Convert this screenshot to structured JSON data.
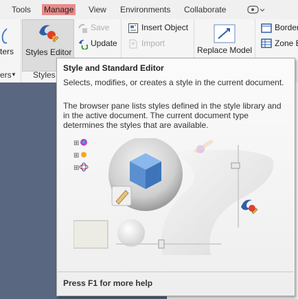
{
  "menubar": {
    "items": [
      {
        "label": "Tools"
      },
      {
        "label": "Manage"
      },
      {
        "label": "View"
      },
      {
        "label": "Environments"
      },
      {
        "label": "Collaborate"
      }
    ],
    "active": "Manage"
  },
  "ribbon": {
    "partial_left": "ters",
    "styles_editor": "Styles Editor",
    "save": "Save",
    "update": "Update",
    "insert_object": "Insert Object",
    "import": "Import",
    "replace_model": "Replace Model",
    "border": "Border",
    "zone": "Zone E",
    "group_partial": "ers",
    "group_styles": "Styles"
  },
  "tooltip": {
    "title": "Style and Standard Editor",
    "description": "Selects, modifies, or creates a style in the current document.",
    "body": "The browser pane lists styles defined in the style library and in the active document. The current document type determines the styles that are available.",
    "footer": "Press F1 for more help"
  },
  "colors": {
    "active_menu": "#e98b8b",
    "left_pane": "#5a6780",
    "tooltip_bg": "#f4f4f4"
  }
}
